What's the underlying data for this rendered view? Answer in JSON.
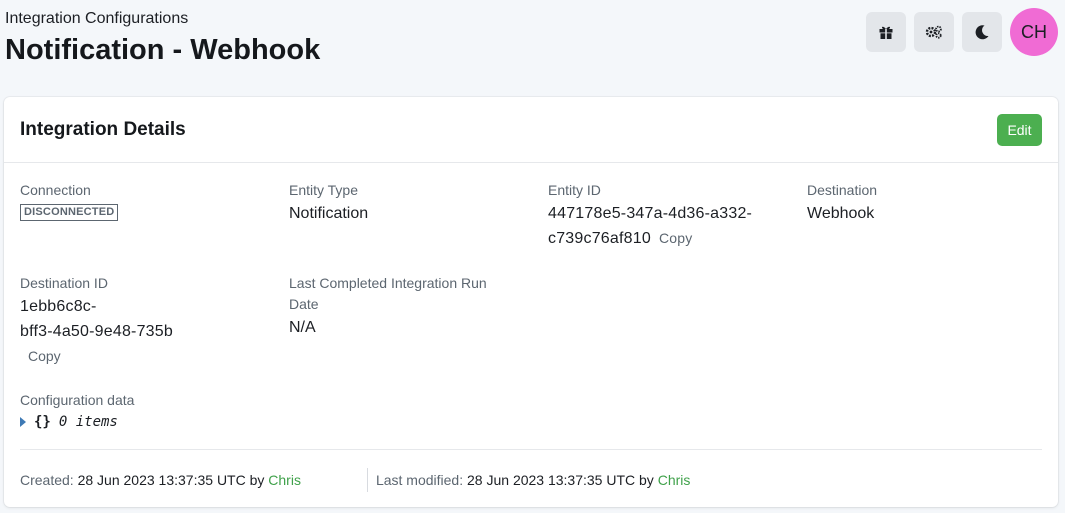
{
  "header": {
    "breadcrumb": "Integration Configurations",
    "title": "Notification - Webhook"
  },
  "toolbar": {
    "gift_icon": "gift-icon",
    "settings_icon": "gears-icon",
    "theme_icon": "moon-icon",
    "avatar_initials": "CH",
    "avatar_color": "#f06bd4"
  },
  "card": {
    "title": "Integration Details",
    "edit_label": "Edit",
    "edit_color": "#4caf50"
  },
  "fields": {
    "connection": {
      "label": "Connection",
      "value": "DISCONNECTED"
    },
    "entity_type": {
      "label": "Entity Type",
      "value": "Notification"
    },
    "entity_id": {
      "label": "Entity ID",
      "value_line1": "447178e5-347a-4d36-a332-",
      "value_line2": "c739c76af810",
      "copy": "Copy"
    },
    "destination": {
      "label": "Destination",
      "value": "Webhook"
    },
    "destination_id": {
      "label": "Destination ID",
      "value_line1": "1ebb6c8c-",
      "value_line2": "bff3-4a50-9e48-735b",
      "copy": "Copy"
    },
    "last_run": {
      "label_line1": "Last Completed Integration Run",
      "label_line2": "Date",
      "value": "N/A"
    },
    "config": {
      "label": "Configuration data",
      "braces": "{}",
      "items": "0 items"
    }
  },
  "footer": {
    "created_label": "Created:",
    "created_value": "28 Jun 2023 13:37:35 UTC by",
    "created_user": "Chris",
    "modified_label": "Last modified:",
    "modified_value": "28 Jun 2023 13:37:35 UTC by",
    "modified_user": "Chris"
  }
}
